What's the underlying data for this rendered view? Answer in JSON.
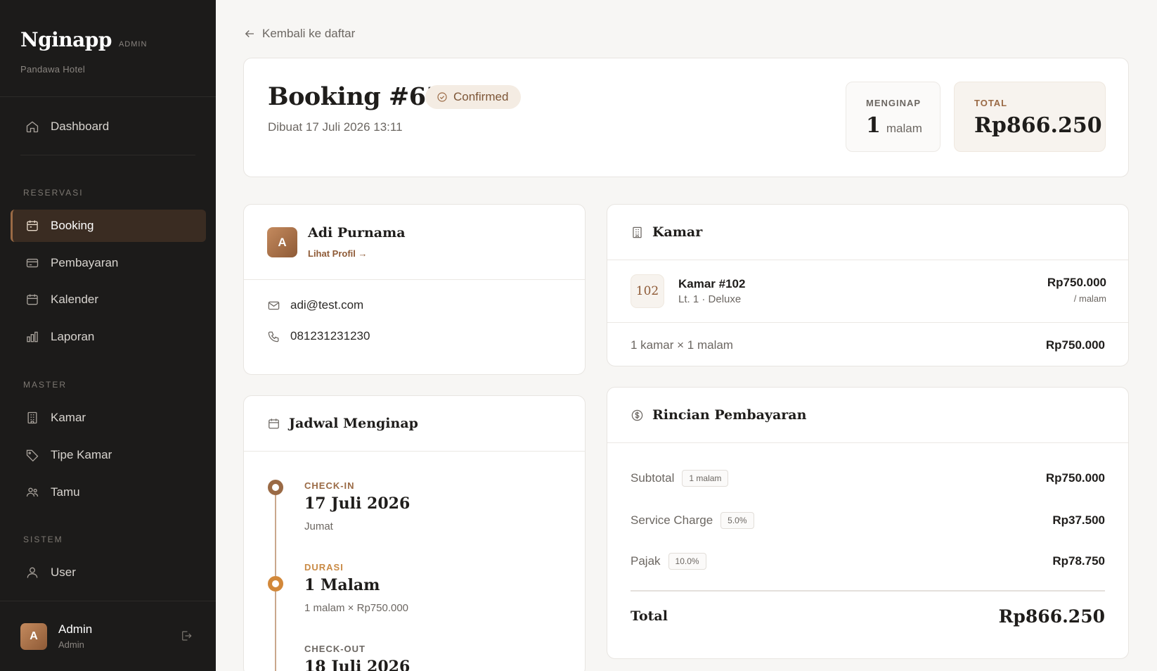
{
  "sidebar": {
    "brand": "Nginapp",
    "brand_tag": "ADMIN",
    "hotel": "Pandawa Hotel",
    "dashboard": "Dashboard",
    "sections": {
      "reservasi": "RESERVASI",
      "master": "MASTER",
      "sistem": "SISTEM"
    },
    "items": {
      "booking": "Booking",
      "pembayaran": "Pembayaran",
      "kalender": "Kalender",
      "laporan": "Laporan",
      "kamar": "Kamar",
      "tipe_kamar": "Tipe Kamar",
      "tamu": "Tamu",
      "user": "User"
    },
    "active_item": "Booking",
    "user": {
      "initial": "A",
      "name": "Admin",
      "role": "Admin"
    }
  },
  "main": {
    "back_label": "Kembali ke daftar",
    "booking_title": "Booking #65",
    "status": "Confirmed",
    "created": "Dibuat 17 Juli 2026 13:11",
    "stats": {
      "nights_label": "MENGINAP",
      "nights_value": "1",
      "nights_unit": "malam",
      "total_label": "TOTAL",
      "total_value": "Rp866.250"
    },
    "guest": {
      "initial": "A",
      "name": "Adi Purnama",
      "profile_link": "Lihat Profil →",
      "email": "adi@test.com",
      "phone": "081231231230"
    },
    "schedule": {
      "title": "Jadwal Menginap",
      "checkin_label": "CHECK-IN",
      "checkin_date": "17 Juli 2026",
      "checkin_day": "Jumat",
      "duration_label": "DURASI",
      "duration_value": "1 Malam",
      "duration_sub": "1 malam × Rp750.000",
      "checkout_label": "CHECK-OUT",
      "checkout_date": "18 Juli 2026"
    },
    "room": {
      "title": "Kamar",
      "number_badge": "102",
      "name": "Kamar #102",
      "sub": "Lt. 1 · Deluxe",
      "price": "Rp750.000",
      "per": "/ malam",
      "summary_label": "1 kamar × 1 malam",
      "summary_value": "Rp750.000"
    },
    "payment": {
      "title": "Rincian Pembayaran",
      "subtotal_label": "Subtotal",
      "subtotal_chip": "1 malam",
      "subtotal_value": "Rp750.000",
      "service_label": "Service Charge",
      "service_chip": "5.0%",
      "service_value": "Rp37.500",
      "tax_label": "Pajak",
      "tax_chip": "10.0%",
      "tax_value": "Rp78.750",
      "total_label": "Total",
      "total_value": "Rp866.250"
    }
  },
  "colors": {
    "accent": "#9a6a45",
    "sidebar_bg": "#1c1b1a",
    "active_nav_bg": "#3a2c22",
    "page_bg": "#f7f6f4"
  }
}
